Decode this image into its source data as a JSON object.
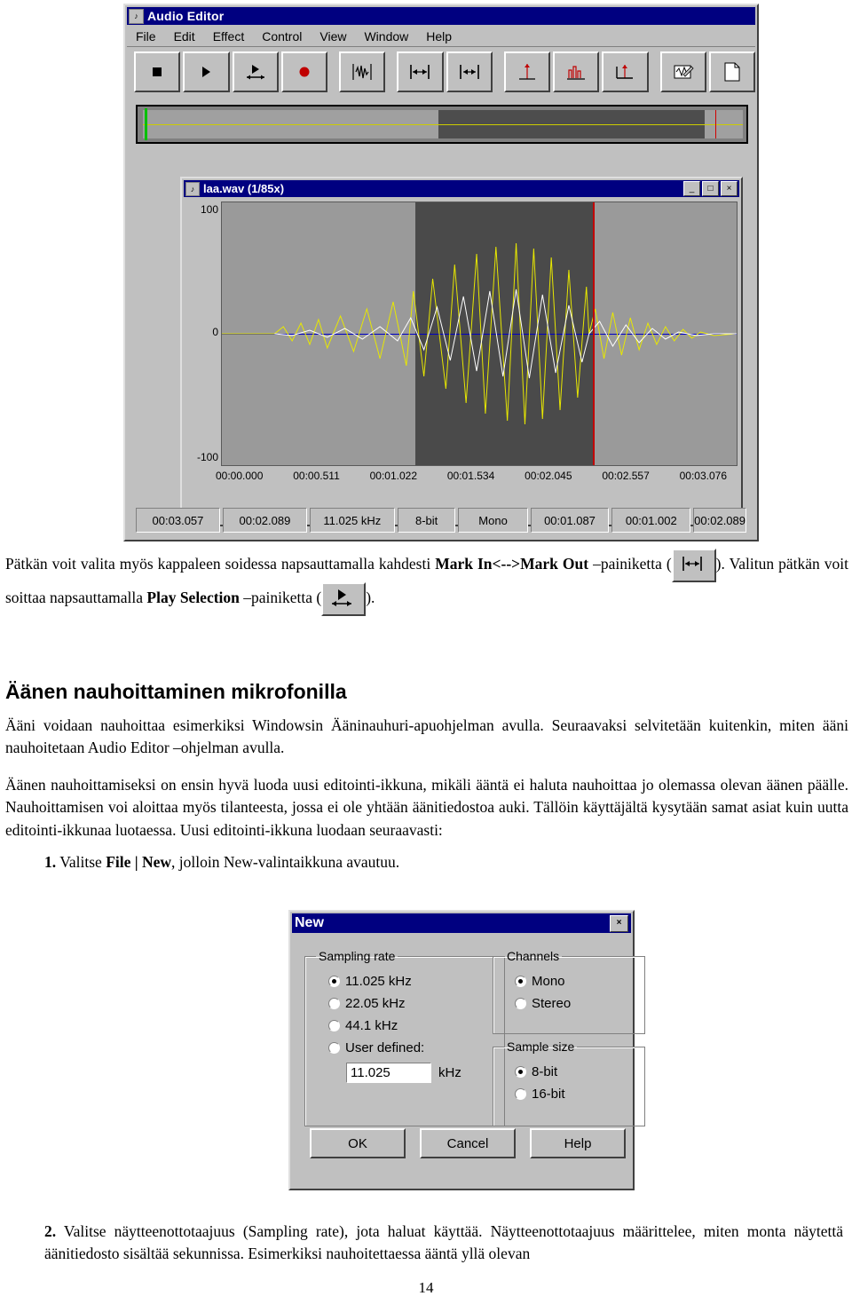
{
  "audio_editor": {
    "title": "Audio Editor",
    "icon": "audio-editor-icon",
    "menu": [
      "File",
      "Edit",
      "Effect",
      "Control",
      "View",
      "Window",
      "Help"
    ],
    "toolbar_buttons": [
      "stop-button",
      "play-button",
      "play-selection-button",
      "record-button",
      "waveform-view-button",
      "mark-in-button",
      "mark-out-button",
      "zoom-in-button",
      "zoom-full-button",
      "zoom-selection-button",
      "edit-button",
      "new-button"
    ],
    "status": [
      "00:03.057",
      "00:02.089",
      "11.025 kHz",
      "8-bit",
      "Mono",
      "00:01.087",
      "00:01.002",
      "00:02.089"
    ],
    "wave_window": {
      "title": "laa.wav (1/85x)",
      "icon": "wave-document-icon",
      "buttons": [
        "_",
        "□",
        "×"
      ],
      "y_labels": [
        "100",
        "0",
        "-100"
      ],
      "x_labels": [
        "00:00.000",
        "00:00.511",
        "00:01.022",
        "00:01.534",
        "00:02.045",
        "00:02.557",
        "00:03.076"
      ]
    }
  },
  "body": {
    "p1_a": "Pätkän voit valita myös kappaleen soidessa napsauttamalla kahdesti ",
    "p1_b": "Mark In<-->Mark Out",
    "p1_c": " –painiketta (",
    "p1_d": "). Valitun pätkän voit soittaa napsauttamalla ",
    "p1_e": "Play Selection",
    "p1_f": " –painiketta (",
    "p1_g": ").",
    "heading": "Äänen nauhoittaminen mikrofonilla",
    "p2": "Ääni voidaan nauhoittaa esimerkiksi Windowsin Ääninauhuri-apuohjelman avulla. Seuraavaksi selvitetään kuitenkin, miten ääni nauhoitetaan Audio Editor –ohjelman avulla.",
    "p3": "Äänen nauhoittamiseksi on ensin hyvä luoda uusi editointi-ikkuna, mikäli ääntä ei haluta nauhoittaa jo olemassa olevan äänen päälle. Nauhoittamisen voi aloittaa myös tilanteesta, jossa ei ole yhtään äänitiedostoa auki. Tällöin käyttäjältä kysytään samat asiat kuin uutta editointi-ikkunaa luotaessa. Uusi editointi-ikkuna luodaan seuraavasti:",
    "step1_num": "1.",
    "step1_a": "Valitse ",
    "step1_b": "File | New",
    "step1_c": ", jolloin New-valintaikkuna avautuu.",
    "step2_num": "2.",
    "step2": "Valitse näytteenottotaajuus (Sampling rate), jota haluat käyttää. Näytteenottotaajuus määrittelee, miten monta näytettä äänitiedosto sisältää sekunnissa. Esimerkiksi nauhoitettaessa ääntä yllä olevan",
    "page_number": "14"
  },
  "new_dialog": {
    "title": "New",
    "close_label": "×",
    "sampling_rate": {
      "legend": "Sampling rate",
      "options": [
        "11.025 kHz",
        "22.05 kHz",
        "44.1 kHz",
        "User defined:"
      ],
      "selected": "11.025 kHz",
      "user_value": "11.025",
      "user_unit": "kHz"
    },
    "channels": {
      "legend": "Channels",
      "options": [
        "Mono",
        "Stereo"
      ],
      "selected": "Mono"
    },
    "sample_size": {
      "legend": "Sample size",
      "options": [
        "8-bit",
        "16-bit"
      ],
      "selected": "8-bit"
    },
    "buttons": [
      "OK",
      "Cancel",
      "Help"
    ]
  }
}
